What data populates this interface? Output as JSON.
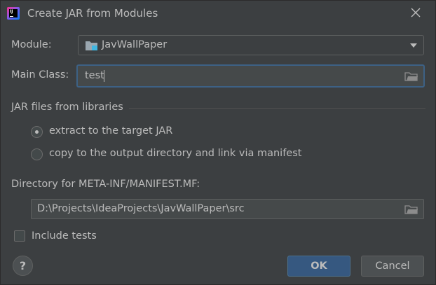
{
  "window": {
    "title": "Create JAR from Modules",
    "icon": "intellij-idea-icon"
  },
  "form": {
    "module_label": "Module:",
    "module_value": "JavWallPaper",
    "main_class_label": "Main Class:",
    "main_class_value": "test",
    "libraries_section_title": "JAR files from libraries",
    "options": [
      {
        "label": "extract to the target JAR",
        "checked": true
      },
      {
        "label": "copy to the output directory and link via manifest",
        "checked": false
      }
    ],
    "manifest_dir_label": "Directory for META-INF/MANIFEST.MF:",
    "manifest_dir_value": "D:\\Projects\\IdeaProjects\\JavWallPaper\\src",
    "include_tests_label": "Include tests",
    "include_tests_checked": false
  },
  "footer": {
    "help_label": "?",
    "ok_label": "OK",
    "cancel_label": "Cancel"
  },
  "colors": {
    "background": "#3c3f41",
    "text": "#bbbbbb",
    "focus_border": "#3d6185",
    "ok_button": "#365880"
  }
}
